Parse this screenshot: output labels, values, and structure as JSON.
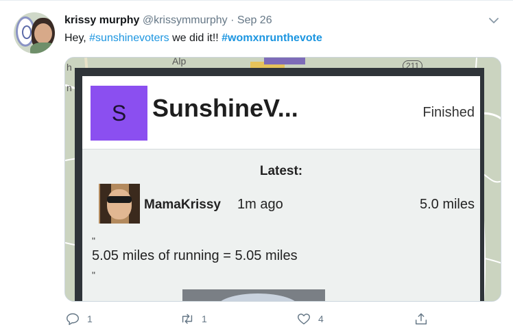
{
  "tweet": {
    "author_name": "krissy murphy",
    "handle": "@krissymmurphy",
    "separator": "·",
    "date": "Sep 26",
    "text_prefix": "Hey, ",
    "hashtag_1": "#sunshinevoters",
    "text_middle": " we did it!! ",
    "hashtag_2": "#womxnrunthevote"
  },
  "media": {
    "map_labels": [
      "Alp",
      "211",
      "h",
      "n"
    ],
    "card": {
      "logo_letter": "S",
      "title": "SunshineV...",
      "status": "Finished",
      "latest_label": "Latest:",
      "runner_name": "MamaKrissy",
      "runner_time": "1m ago",
      "runner_distance": "5.0 miles",
      "quote_open": "\"",
      "description": "5.05 miles of running = 5.05 miles",
      "quote_close": "\""
    }
  },
  "actions": {
    "reply_count": "1",
    "retweet_count": "1",
    "like_count": "4"
  },
  "icons": [
    "chevron-down-icon",
    "reply-icon",
    "retweet-icon",
    "like-icon",
    "share-icon"
  ],
  "colors": {
    "link": "#1b95e0",
    "muted": "#657786",
    "logo": "#8b4ff0"
  }
}
